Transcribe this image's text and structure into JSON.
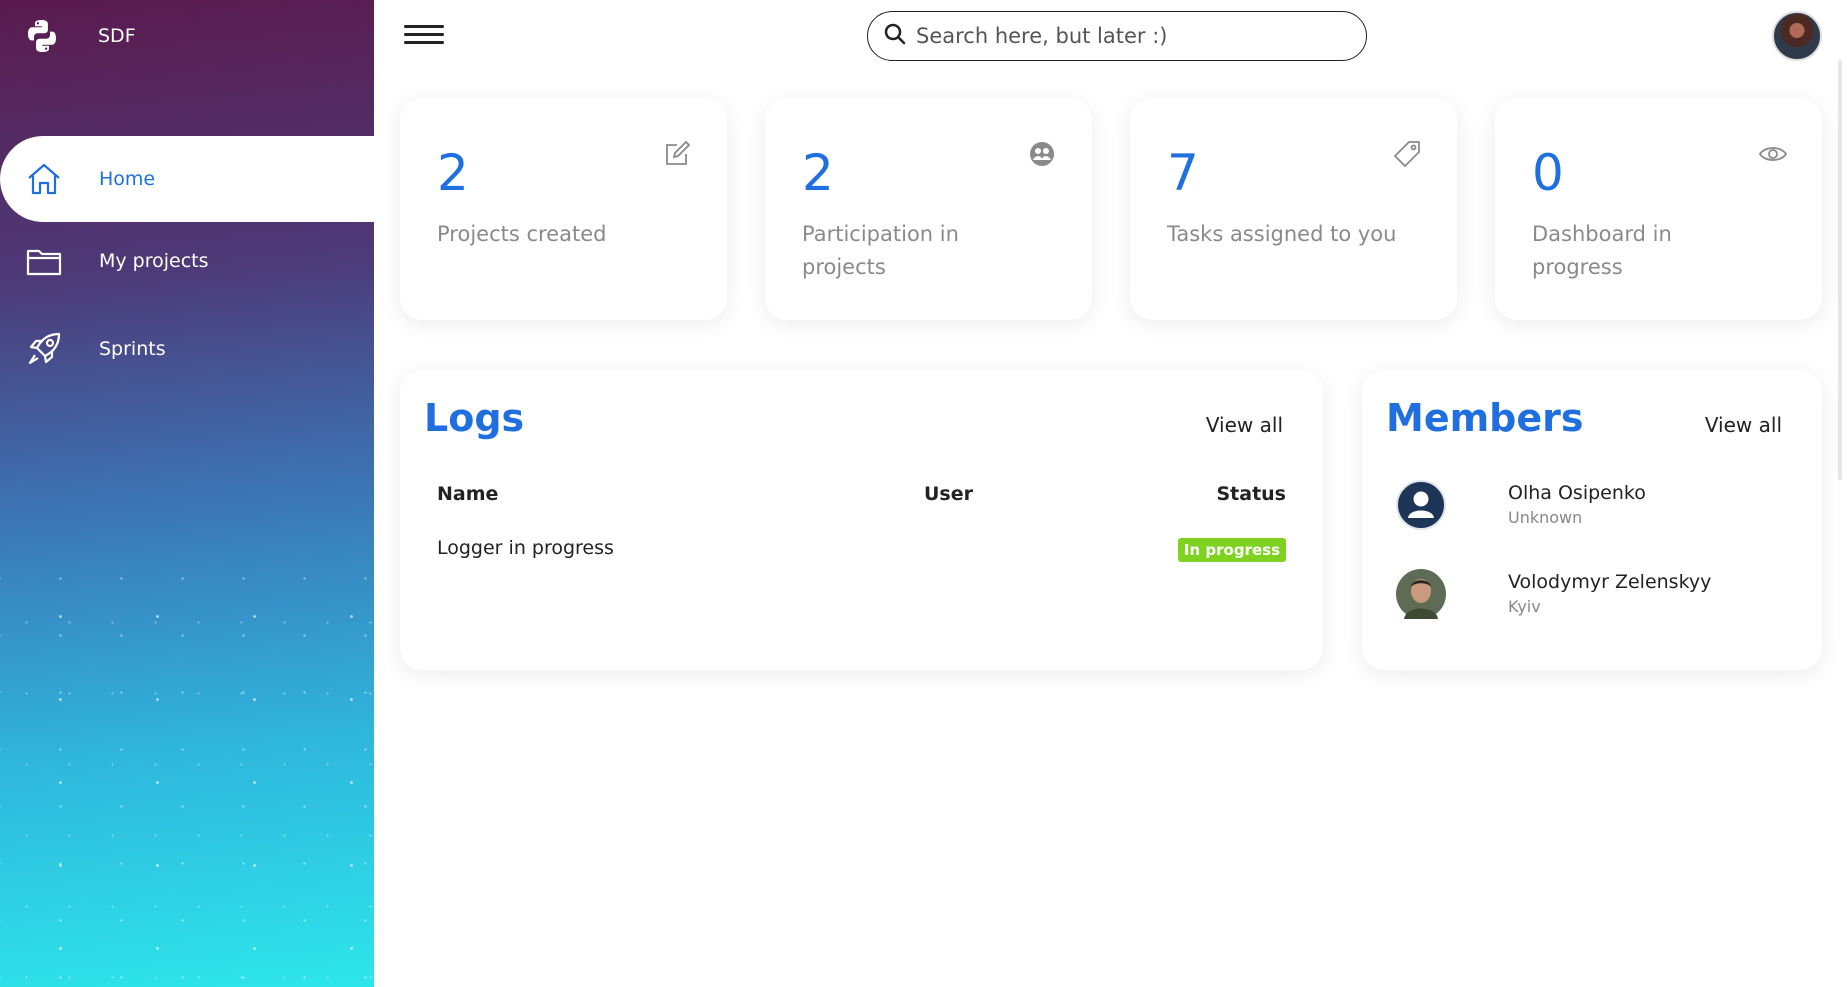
{
  "brand": {
    "name": "SDF"
  },
  "sidebar": {
    "items": [
      {
        "label": "Home",
        "icon": "home-icon",
        "active": true
      },
      {
        "label": "My projects",
        "icon": "folder-icon",
        "active": false
      },
      {
        "label": "Sprints",
        "icon": "rocket-icon",
        "active": false
      }
    ]
  },
  "header": {
    "search_placeholder": "Search here, but later :)"
  },
  "stats": [
    {
      "value": "2",
      "label": "Projects created",
      "icon": "edit-icon"
    },
    {
      "value": "2",
      "label": "Participation in projects",
      "icon": "group-icon"
    },
    {
      "value": "7",
      "label": "Tasks assigned to you",
      "icon": "tag-icon"
    },
    {
      "value": "0",
      "label": "Dashboard in progress",
      "icon": "eye-icon"
    }
  ],
  "logs": {
    "title": "Logs",
    "view_all": "View all",
    "columns": [
      "Name",
      "User",
      "Status"
    ],
    "rows": [
      {
        "name": "Logger in progress",
        "user": "",
        "status": "In progress"
      }
    ]
  },
  "members": {
    "title": "Members",
    "view_all": "View all",
    "list": [
      {
        "name": "Olha Osipenko",
        "location": "Unknown"
      },
      {
        "name": "Volodymyr Zelenskyy",
        "location": "Kyiv"
      }
    ]
  },
  "colors": {
    "accent": "#1f6fe0",
    "badge_green": "#7ed321"
  }
}
